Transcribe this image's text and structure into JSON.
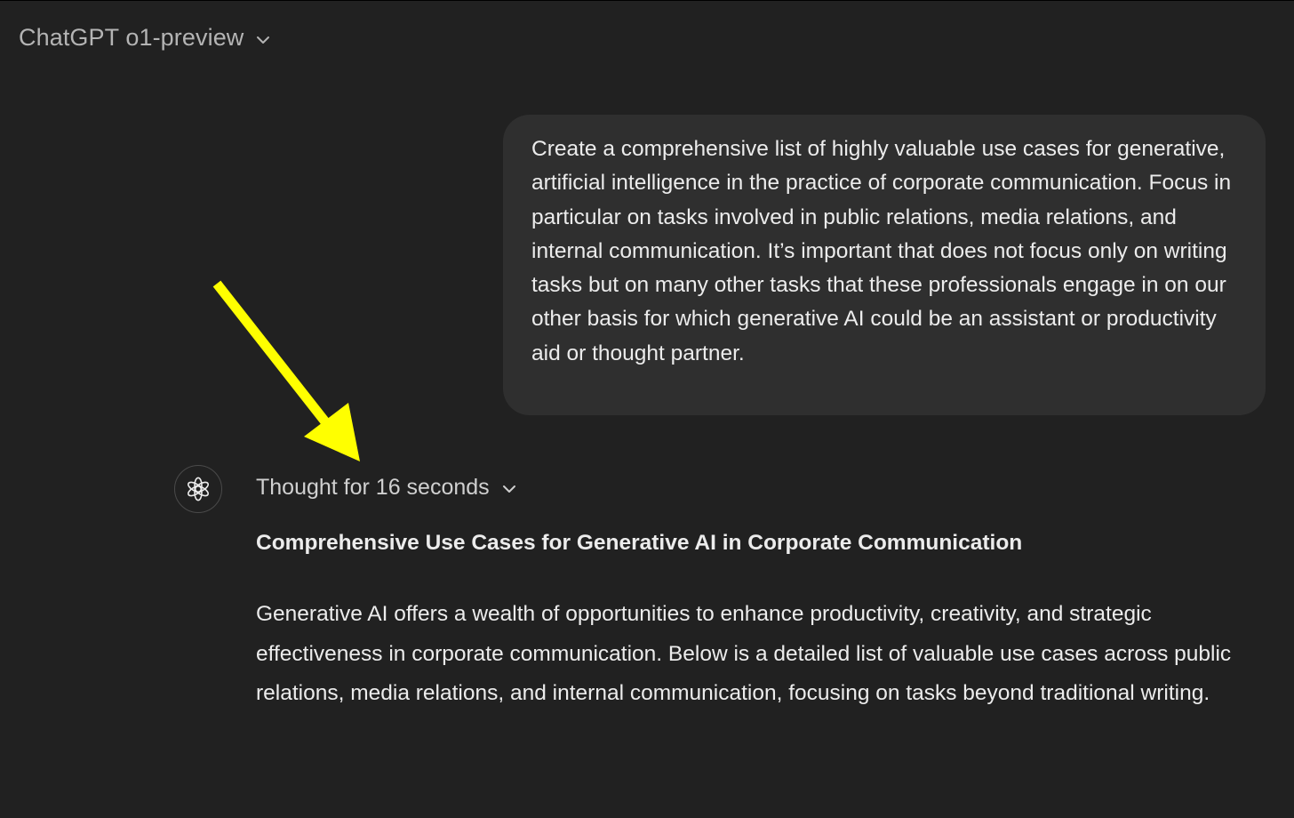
{
  "header": {
    "model_name": "ChatGPT o1-preview",
    "chevron_icon": "chevron-down-icon"
  },
  "conversation": {
    "user_message": "Create a comprehensive list of highly valuable use cases for generative, artificial intelligence in the practice of corporate communication. Focus in particular on tasks involved in public relations, media relations, and internal communication. It’s important that does not focus only on writing tasks but on many other tasks that these professionals engage in on our other basis for which generative AI could be an assistant or productivity aid or thought partner.",
    "assistant": {
      "avatar_icon": "openai-logo-icon",
      "thought_label": "Thought for 16 seconds",
      "heading": "Comprehensive Use Cases for Generative AI in Corporate Communication",
      "intro": "Generative AI offers a wealth of opportunities to enhance productivity, creativity, and strategic effectiveness in corporate communication. Below is a detailed list of valuable use cases across public relations, media relations, and internal communication, focusing on tasks beyond traditional writing."
    }
  },
  "annotation": {
    "arrow_color": "#ffff00"
  },
  "colors": {
    "background": "#212121",
    "user_bubble": "#2f2f2f",
    "text": "#ececec",
    "muted_text": "#b4b4b4"
  }
}
